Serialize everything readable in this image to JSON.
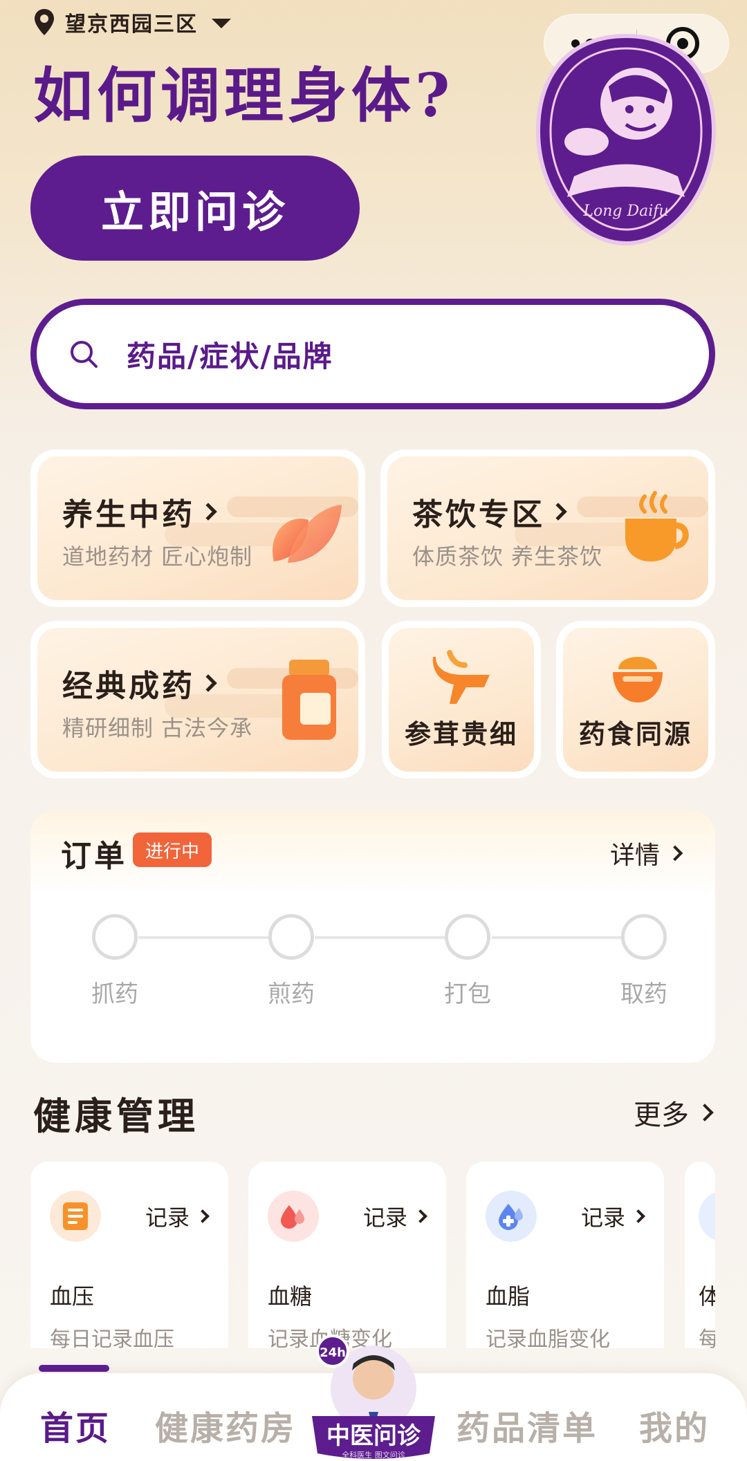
{
  "header": {
    "location": "望京西园三区",
    "headline": "如何调理身体?",
    "cta_label": "立即问诊",
    "mascot_text": "Long Daifu"
  },
  "search": {
    "placeholder": "药品/症状/品牌"
  },
  "categories": [
    {
      "title": "养生中药",
      "subtitle": "道地药材 匠心炮制"
    },
    {
      "title": "茶饮专区",
      "subtitle": "体质茶饮 养生茶饮"
    },
    {
      "title": "经典成药",
      "subtitle": "精研细制 古法今承"
    },
    {
      "title": "参茸贵细"
    },
    {
      "title": "药食同源"
    }
  ],
  "order": {
    "title": "订单",
    "badge": "进行中",
    "detail_label": "详情",
    "steps": [
      "抓药",
      "煎药",
      "打包",
      "取药"
    ]
  },
  "health": {
    "title": "健康管理",
    "more_label": "更多",
    "record_label": "记录",
    "items": [
      {
        "name": "血压",
        "desc": "每日记录血压"
      },
      {
        "name": "血糖",
        "desc": "记录血糖变化"
      },
      {
        "name": "血脂",
        "desc": "记录血脂变化"
      },
      {
        "name": "体",
        "desc": "每"
      }
    ]
  },
  "tabbar": {
    "tabs": [
      "首页",
      "健康药房",
      "药品清单",
      "我的"
    ],
    "center_label": "中医问诊",
    "center_badge": "24h",
    "center_sub": "全科医生 图文问诊"
  },
  "colors": {
    "brand": "#5d1d8e",
    "badge": "#f2643a",
    "background": "#f7f2ec"
  }
}
